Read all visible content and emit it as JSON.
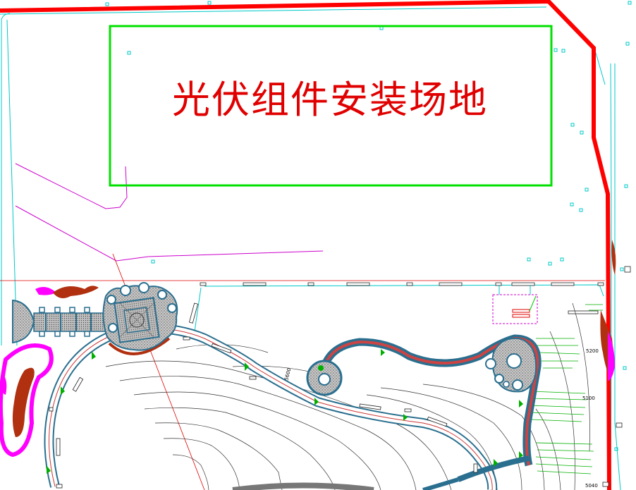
{
  "plan": {
    "title": "光伏组件安装场地",
    "elevation_labels": {
      "e1": "5200",
      "e2": "5100",
      "e3": "5040",
      "e4": "5600"
    },
    "colors": {
      "boundary": "#ff0000",
      "install_zone": "#00e000",
      "title": "#e00000",
      "cyan_lines": "#00c8c8",
      "magenta_lines": "#cc00cc",
      "path_blue": "#2a6f8f",
      "contour": "#333333",
      "planting_green": "#00b000"
    }
  }
}
